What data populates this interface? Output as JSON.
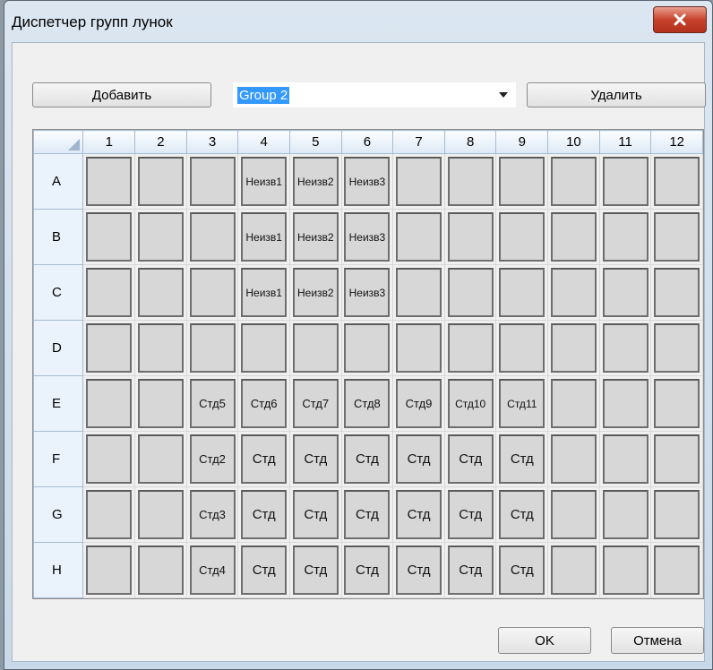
{
  "window": {
    "title": "Диспетчер групп лунок"
  },
  "toolbar": {
    "add_label": "Добавить",
    "delete_label": "Удалить",
    "group_value": "Group 2"
  },
  "footer": {
    "ok_label": "OK",
    "cancel_label": "Отмена"
  },
  "columns": [
    "1",
    "2",
    "3",
    "4",
    "5",
    "6",
    "7",
    "8",
    "9",
    "10",
    "11",
    "12"
  ],
  "rows": [
    {
      "label": "A",
      "cells": [
        "",
        "",
        "",
        "Неизв1",
        "Неизв2",
        "Неизв3",
        "",
        "",
        "",
        "",
        "",
        ""
      ]
    },
    {
      "label": "B",
      "cells": [
        "",
        "",
        "",
        "Неизв1",
        "Неизв2",
        "Неизв3",
        "",
        "",
        "",
        "",
        "",
        ""
      ]
    },
    {
      "label": "C",
      "cells": [
        "",
        "",
        "",
        "Неизв1",
        "Неизв2",
        "Неизв3",
        "",
        "",
        "",
        "",
        "",
        ""
      ]
    },
    {
      "label": "D",
      "cells": [
        "",
        "",
        "",
        "",
        "",
        "",
        "",
        "",
        "",
        "",
        "",
        ""
      ]
    },
    {
      "label": "E",
      "cells": [
        "",
        "",
        "Стд5",
        "Стд6",
        "Стд7",
        "Стд8",
        "Стд9",
        "Стд10",
        "Стд11",
        "",
        "",
        ""
      ]
    },
    {
      "label": "F",
      "cells": [
        "",
        "",
        "Стд2",
        "Стд",
        "Стд",
        "Стд",
        "Стд",
        "Стд",
        "Стд",
        "",
        "",
        ""
      ]
    },
    {
      "label": "G",
      "cells": [
        "",
        "",
        "Стд3",
        "Стд",
        "Стд",
        "Стд",
        "Стд",
        "Стд",
        "Стд",
        "",
        "",
        ""
      ]
    },
    {
      "label": "H",
      "cells": [
        "",
        "",
        "Стд4",
        "Стд",
        "Стд",
        "Стд",
        "Стд",
        "Стд",
        "Стд",
        "",
        "",
        ""
      ]
    }
  ],
  "icons": {
    "close": "close-icon",
    "dropdown": "chevron-down-icon"
  },
  "colors": {
    "title_bar": "#dbe6f1",
    "close_button": "#c6422c",
    "selection": "#3399ff",
    "well_fill": "#d7d7d7"
  }
}
